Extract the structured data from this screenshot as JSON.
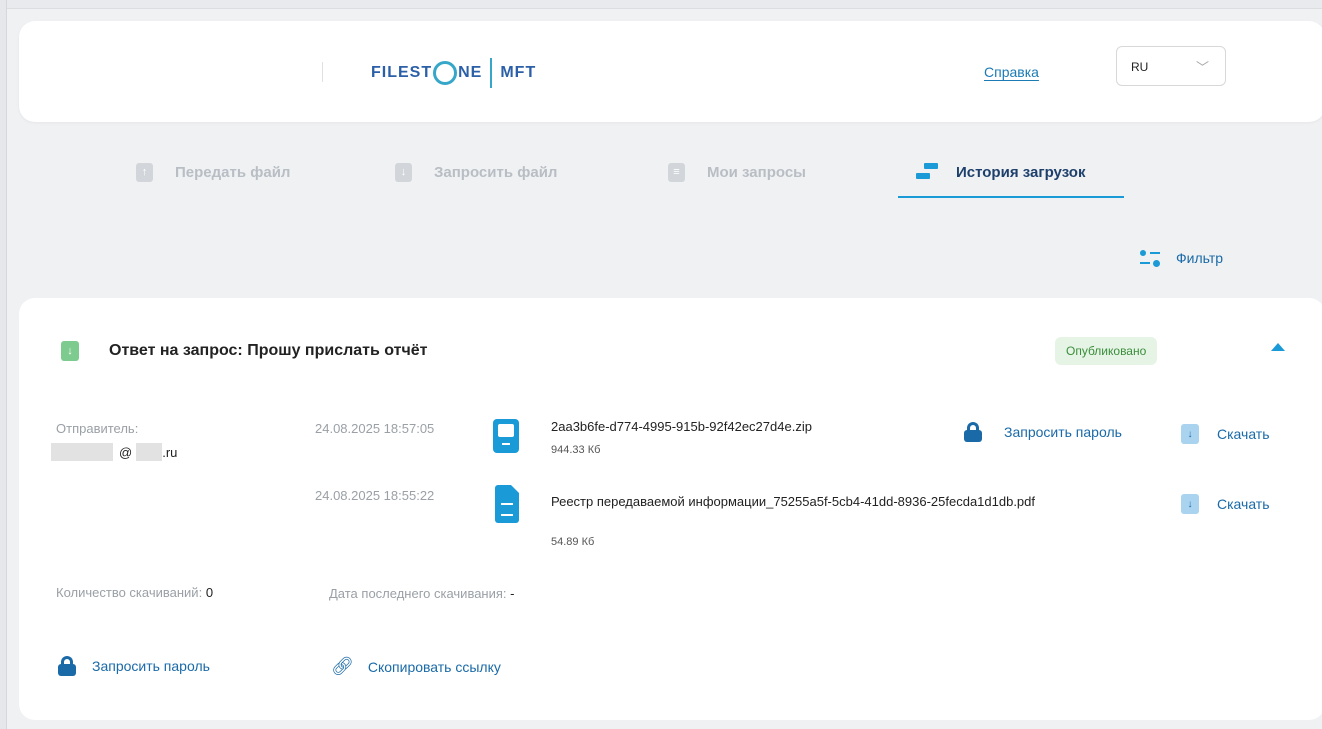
{
  "header": {
    "logo_left": "FILEST",
    "logo_mid": "NE",
    "logo_right": "MFT",
    "help_link": "Справка",
    "language": "RU"
  },
  "tabs": [
    {
      "label": "Передать файл",
      "icon": "upload-icon",
      "active": false
    },
    {
      "label": "Запросить файл",
      "icon": "download-icon",
      "active": false
    },
    {
      "label": "Мои запросы",
      "icon": "document-icon",
      "active": false
    },
    {
      "label": "История загрузок",
      "icon": "transfer-icon",
      "active": true
    }
  ],
  "filter_label": "Фильтр",
  "card": {
    "title": "Ответ на запрос: Прошу прислать отчёт",
    "status": "Опубликовано",
    "sender_label": "Отправитель:",
    "sender_at": "@",
    "sender_domain": ".ru",
    "files": [
      {
        "date": "24.08.2025 18:57:05",
        "name": "2aa3b6fe-d774-4995-915b-92f42ec27d4e.zip",
        "size": "944.33 Кб",
        "icon": "archive-icon",
        "request_password": "Запросить пароль",
        "download": "Скачать"
      },
      {
        "date": "24.08.2025 18:55:22",
        "name": "Реестр передаваемой информации_75255a5f-5cb4-41dd-8936-25fecda1d1db.pdf",
        "size": "54.89 Кб",
        "icon": "pdf-file-icon",
        "download": "Скачать"
      }
    ],
    "downloads_count_label": "Количество скачиваний:",
    "downloads_count": "0",
    "last_download_label": "Дата последнего скачивания:",
    "last_download": "-",
    "request_password": "Запросить пароль",
    "copy_link": "Скопировать ссылку"
  },
  "colors": {
    "accent": "#1a9ad6",
    "link": "#1a6aa8",
    "status_bg": "#e6f4e6",
    "status_text": "#3b8d3b"
  }
}
